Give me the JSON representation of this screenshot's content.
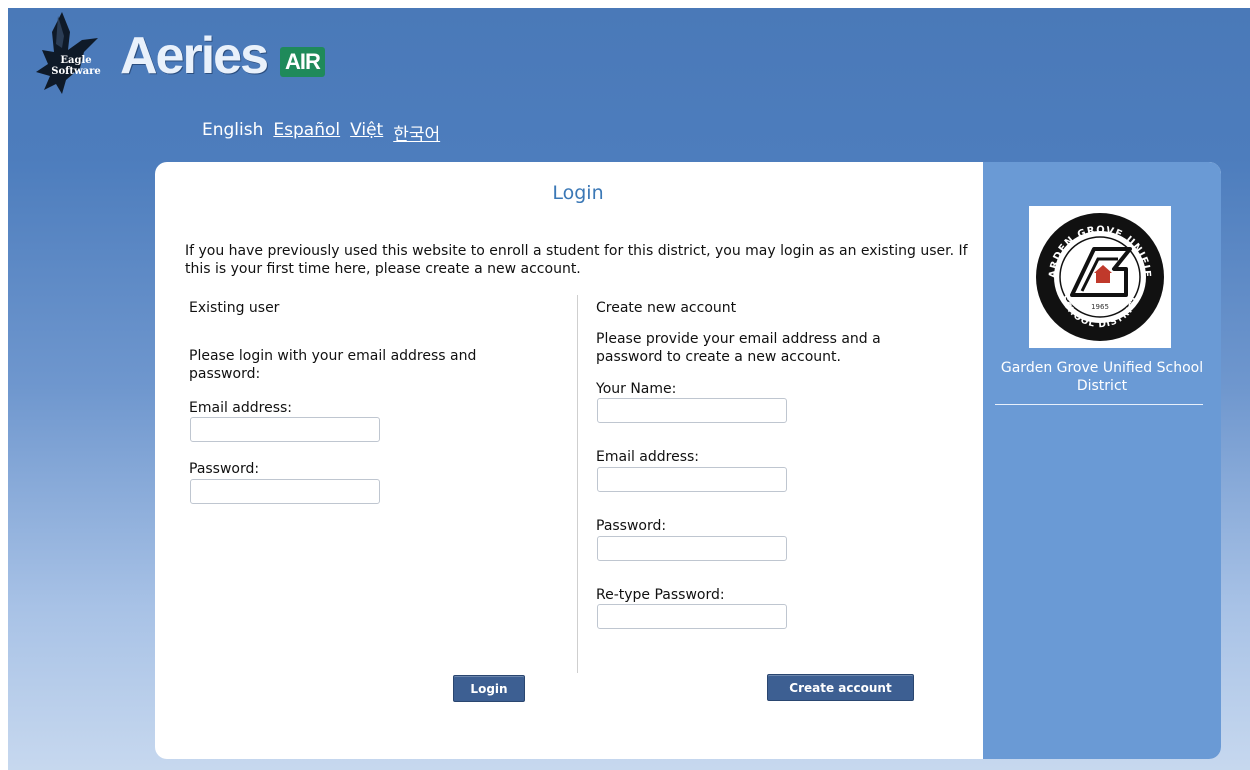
{
  "header": {
    "eagle_line1": "Eagle",
    "eagle_line2": "Software",
    "brand": "Aeries",
    "brand_badge": "AIR"
  },
  "languages": {
    "current": "English",
    "links": [
      "Español",
      "Việt",
      "한국어"
    ]
  },
  "login_page": {
    "title": "Login",
    "intro": "If you have previously used this website to enroll a student for this district, you may login as an existing user. If this is your first time here, please create a new account."
  },
  "existing_user": {
    "heading": "Existing user",
    "instructions": "Please login with your email address and password:",
    "email_label": "Email address:",
    "email_value": "",
    "password_label": "Password:",
    "password_value": "",
    "login_button": "Login"
  },
  "new_account": {
    "heading": "Create new account",
    "instructions": "Please provide your email address and a password to create a new account.",
    "name_label": "Your Name:",
    "email_label": "Email address:",
    "password_label": "Password:",
    "retype_label": "Re-type Password:",
    "create_button": "Create account"
  },
  "district": {
    "name": "Garden Grove Unified School District",
    "seal_top": "GARDEN GROVE UNIFIED",
    "seal_bottom": "SCHOOL DISTRICT",
    "seal_year": "1965"
  },
  "colors": {
    "accent": "#3b78b6",
    "sidebar": "#6a9ad5",
    "button": "#3d5f92",
    "badge": "#1f8a5a"
  },
  "icons": [
    "eagle-logo-icon",
    "district-seal-icon"
  ]
}
